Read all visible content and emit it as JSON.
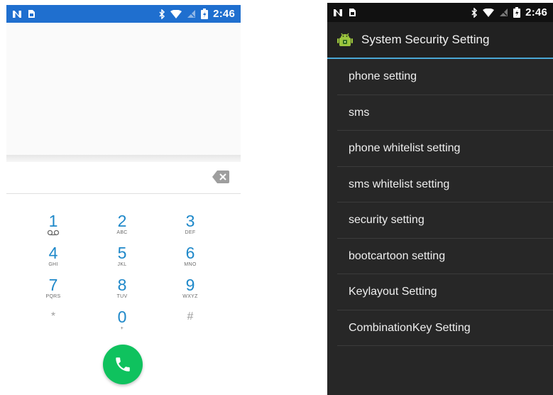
{
  "dialer": {
    "status_bar": {
      "time": "2:46",
      "left_icons": [
        "n-icon",
        "sim-icon"
      ],
      "right_icons": [
        "bluetooth-icon",
        "wifi-icon",
        "no-sim-icon",
        "battery-icon"
      ]
    },
    "keys": [
      {
        "num": "1",
        "letters": "",
        "name": "key-1"
      },
      {
        "num": "2",
        "letters": "ABC",
        "name": "key-2"
      },
      {
        "num": "3",
        "letters": "DEF",
        "name": "key-3"
      },
      {
        "num": "4",
        "letters": "GHI",
        "name": "key-4"
      },
      {
        "num": "5",
        "letters": "JKL",
        "name": "key-5"
      },
      {
        "num": "6",
        "letters": "MNO",
        "name": "key-6"
      },
      {
        "num": "7",
        "letters": "PQRS",
        "name": "key-7"
      },
      {
        "num": "8",
        "letters": "TUV",
        "name": "key-8"
      },
      {
        "num": "9",
        "letters": "WXYZ",
        "name": "key-9"
      },
      {
        "num": "*",
        "letters": "",
        "name": "key-star"
      },
      {
        "num": "0",
        "letters": "+",
        "name": "key-0"
      },
      {
        "num": "#",
        "letters": "",
        "name": "key-hash"
      }
    ],
    "colors": {
      "status_bar": "#1f6fcf",
      "digit": "#1e88c9",
      "call_button": "#0fc25e"
    }
  },
  "settings": {
    "status_bar": {
      "time": "2:46",
      "left_icons": [
        "n-icon",
        "sim-icon"
      ],
      "right_icons": [
        "bluetooth-icon",
        "wifi-icon",
        "no-sim-icon",
        "battery-icon"
      ]
    },
    "title": "System Security Setting",
    "app_icon": "android-icon",
    "items": [
      "phone setting",
      "sms",
      "phone whitelist setting",
      "sms whitelist setting",
      "security setting",
      "bootcartoon setting",
      "Keylayout Setting",
      "CombinationKey Setting"
    ],
    "colors": {
      "accent": "#4aa8d6",
      "background": "#272727"
    }
  }
}
